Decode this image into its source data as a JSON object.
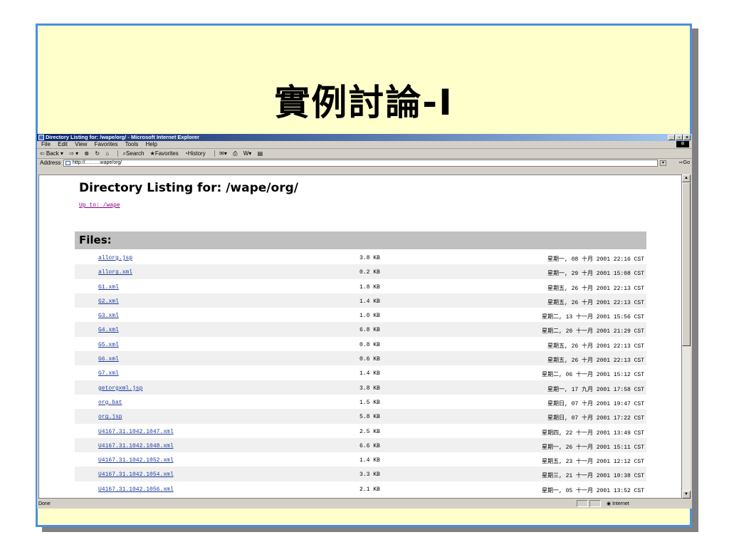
{
  "slide": {
    "title": "實例討論-I"
  },
  "window": {
    "title": "Directory Listing for: /wape/org/ - Microsoft Internet Explorer",
    "controls": [
      "_",
      "▫",
      "×"
    ],
    "menu": [
      "File",
      "Edit",
      "View",
      "Favorites",
      "Tools",
      "Help"
    ],
    "toolbar": {
      "back": "⇦ Back ▾",
      "forward": "⇨ ▾",
      "search": "Search",
      "favorites": "Favorites",
      "history": "History"
    },
    "address_label": "Address",
    "address_value": "http://………wape/org/",
    "go_label": "Go",
    "status_text": "Done",
    "zone_text": "Internet"
  },
  "page": {
    "heading": "Directory Listing for: /wape/org/",
    "up_link": "Up to: /wape",
    "files_header": "Files:",
    "files": [
      {
        "name": "allorg.jsp",
        "size": "3.8 KB",
        "date": "星期一, 08 十月 2001 22:16 CST"
      },
      {
        "name": "allorg.xml",
        "size": "0.2 KB",
        "date": "星期一, 29 十月 2001 15:08 CST"
      },
      {
        "name": "G1.xml",
        "size": "1.8 KB",
        "date": "星期五, 26 十月 2001 22:13 CST"
      },
      {
        "name": "G2.xml",
        "size": "1.4 KB",
        "date": "星期五, 26 十月 2001 22:13 CST"
      },
      {
        "name": "G3.xml",
        "size": "1.0 KB",
        "date": "星期二, 13 十一月 2001 15:56 CST"
      },
      {
        "name": "G4.xml",
        "size": "6.8 KB",
        "date": "星期二, 20 十一月 2001 21:29 CST"
      },
      {
        "name": "G5.xml",
        "size": "0.8 KB",
        "date": "星期五, 26 十月 2001 22:13 CST"
      },
      {
        "name": "G6.xml",
        "size": "0.6 KB",
        "date": "星期五, 26 十月 2001 22:13 CST"
      },
      {
        "name": "G7.xml",
        "size": "1.4 KB",
        "date": "星期二, 06 十一月 2001 15:12 CST"
      },
      {
        "name": "getorgxml.jsp",
        "size": "3.8 KB",
        "date": "星期一, 17 九月 2001 17:58 CST"
      },
      {
        "name": "org.bat",
        "size": "1.5 KB",
        "date": "星期日, 07 十月 2001 19:47 CST"
      },
      {
        "name": "org.jsp",
        "size": "5.8 KB",
        "date": "星期日, 07 十月 2001 17:22 CST"
      },
      {
        "name": "U4167.31.1042.1047.xml",
        "size": "2.5 KB",
        "date": "星期四, 22 十一月 2001 13:49 CST"
      },
      {
        "name": "U4167.31.1042.1048.xml",
        "size": "6.6 KB",
        "date": "星期一, 26 十一月 2001 15:11 CST"
      },
      {
        "name": "U4167.31.1042.1052.xml",
        "size": "1.4 KB",
        "date": "星期五, 23 十一月 2001 12:12 CST"
      },
      {
        "name": "U4167.31.1042.1054.xml",
        "size": "3.3 KB",
        "date": "星期三, 21 十一月 2001 10:38 CST"
      },
      {
        "name": "U4167.31.1042.1056.xml",
        "size": "2.1 KB",
        "date": "星期一, 05 十一月 2001 13:52 CST"
      }
    ]
  }
}
